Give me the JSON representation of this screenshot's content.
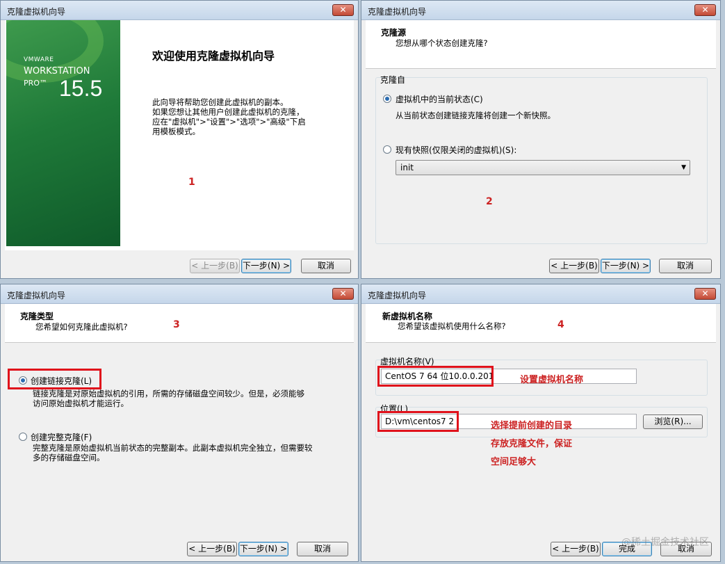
{
  "common": {
    "window_title": "克隆虚拟机向导",
    "close_glyph": "✕",
    "back_label": "< 上一步(B)",
    "next_label": "下一步(N) >",
    "cancel_label": "取消",
    "finish_label": "完成"
  },
  "w1": {
    "logo_vmware": "VMWARE",
    "logo_workstation": "WORKSTATION",
    "logo_pro": "PRO™",
    "logo_version": "15.5",
    "heading": "欢迎使用克隆虚拟机向导",
    "intro_1": "此向导将帮助您创建此虚拟机的副本。",
    "intro_2": "如果您想让其他用户创建此虚拟机的克隆，",
    "intro_3": "应在\"虚拟机\">\"设置\">\"选项\">\"高级\"下启",
    "intro_4": "用模板模式。",
    "step": "1"
  },
  "w2": {
    "header_title": "克隆源",
    "header_sub": "您想从哪个状态创建克隆?",
    "group_label": "克隆自",
    "option_current": "虚拟机中的当前状态(C)",
    "option_current_desc": "从当前状态创建链接克隆将创建一个新快照。",
    "option_snapshot": "现有快照(仅限关闭的虚拟机)(S):",
    "snapshot_value": "init",
    "step": "2"
  },
  "w3": {
    "header_title": "克隆类型",
    "header_sub": "您希望如何克隆此虚拟机?",
    "step": "3",
    "option_linked": "创建链接克隆(L)",
    "option_linked_desc_1": "链接克隆是对原始虚拟机的引用，所需的存储磁盘空间较少。但是，必须能够",
    "option_linked_desc_2": "访问原始虚拟机才能运行。",
    "option_full": "创建完整克隆(F)",
    "option_full_desc_1": "完整克隆是原始虚拟机当前状态的完整副本。此副本虚拟机完全独立，但需要较",
    "option_full_desc_2": "多的存储磁盘空间。"
  },
  "w4": {
    "header_title": "新虚拟机名称",
    "header_sub": "您希望该虚拟机使用什么名称?",
    "step": "4",
    "name_label": "虚拟机名称(V)",
    "name_value": "CentOS 7 64 位10.0.0.201",
    "name_note": "设置虚拟机名称",
    "location_label": "位置(L)",
    "location_value": "D:\\vm\\centos7 2",
    "browse_label": "浏览(R)...",
    "location_note_1": "选择提前创建的目录",
    "location_note_2": "存放克隆文件，保证",
    "location_note_3": "空间足够大",
    "watermark": "@稀土掘金技术社区"
  }
}
